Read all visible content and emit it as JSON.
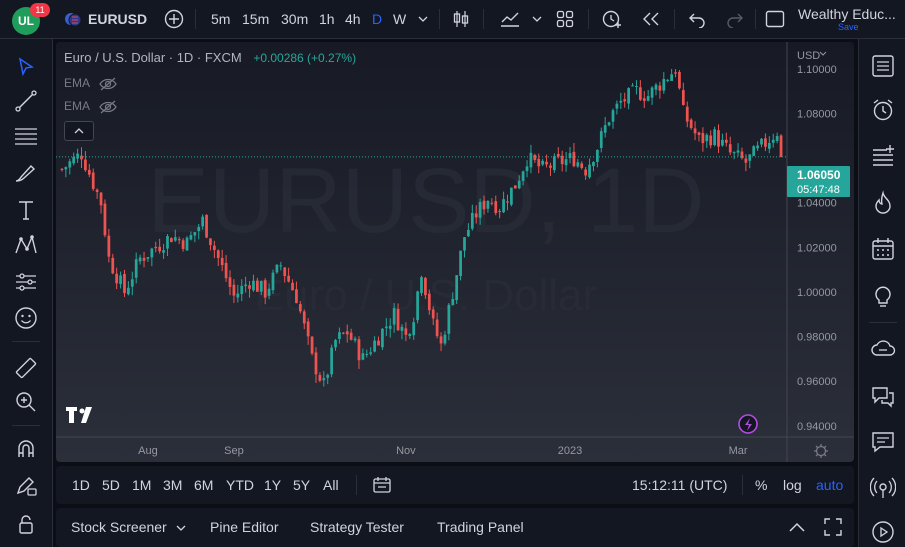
{
  "topbar": {
    "logo_text": "UL",
    "notification_count": "11",
    "symbol": "EURUSD",
    "intervals": [
      "5m",
      "15m",
      "30m",
      "1h",
      "4h",
      "D",
      "W"
    ],
    "active_interval": "D",
    "account_name": "Wealthy Educ...",
    "save_label": "Save",
    "accent_color": "#2962ff"
  },
  "legend": {
    "symbol_title": "Euro / U.S. Dollar · 1D · FXCM",
    "change": "+0.00286 (+0.27%)",
    "change_color": "#26a69a",
    "indicators": [
      "EMA",
      "EMA"
    ]
  },
  "watermark": {
    "line1": "EURUSD, 1D",
    "line2": "Euro / U.S. Dollar"
  },
  "price_axis": {
    "currency": "USD",
    "current_price": "1.06050",
    "countdown": "05:47:48",
    "current_price_color": "#26a69a"
  },
  "bottom_toolbar": {
    "ranges": [
      "1D",
      "5D",
      "1M",
      "3M",
      "6M",
      "YTD",
      "1Y",
      "5Y",
      "All"
    ],
    "time": "15:12:11 (UTC)",
    "percent": "%",
    "log": "log",
    "auto": "auto"
  },
  "panel_bar": {
    "tabs": [
      "Stock Screener",
      "Pine Editor",
      "Strategy Tester",
      "Trading Panel"
    ]
  },
  "chart_data": {
    "type": "candlestick",
    "y_ticks": [
      "1.10000",
      "1.08000",
      "1.04000",
      "1.02000",
      "1.00000",
      "0.98000",
      "0.96000",
      "0.94000"
    ],
    "ylim": [
      0.935,
      1.112
    ],
    "x_ticks": [
      {
        "label": "Aug",
        "index": 22
      },
      {
        "label": "Sep",
        "index": 44
      },
      {
        "label": "Nov",
        "index": 88
      },
      {
        "label": "2023",
        "index": 130
      },
      {
        "label": "Mar",
        "index": 173
      }
    ],
    "n_bars": 185,
    "anchors": [
      [
        0,
        1.055
      ],
      [
        5,
        1.062
      ],
      [
        10,
        1.04
      ],
      [
        12,
        1.015
      ],
      [
        16,
        1.0
      ],
      [
        20,
        1.015
      ],
      [
        24,
        1.02
      ],
      [
        28,
        1.025
      ],
      [
        32,
        1.022
      ],
      [
        36,
        1.032
      ],
      [
        40,
        1.015
      ],
      [
        44,
        0.998
      ],
      [
        48,
        1.005
      ],
      [
        52,
        1.0
      ],
      [
        56,
        1.012
      ],
      [
        60,
        0.998
      ],
      [
        64,
        0.97
      ],
      [
        67,
        0.958
      ],
      [
        70,
        0.978
      ],
      [
        73,
        0.982
      ],
      [
        77,
        0.97
      ],
      [
        81,
        0.98
      ],
      [
        85,
        0.99
      ],
      [
        88,
        0.98
      ],
      [
        90,
        0.99
      ],
      [
        92,
        1.01
      ],
      [
        95,
        0.985
      ],
      [
        97,
        0.976
      ],
      [
        100,
        1.0
      ],
      [
        103,
        1.025
      ],
      [
        106,
        1.035
      ],
      [
        109,
        1.042
      ],
      [
        112,
        1.038
      ],
      [
        116,
        1.048
      ],
      [
        119,
        1.06
      ],
      [
        123,
        1.055
      ],
      [
        127,
        1.058
      ],
      [
        131,
        1.06
      ],
      [
        134,
        1.055
      ],
      [
        137,
        1.065
      ],
      [
        140,
        1.078
      ],
      [
        143,
        1.085
      ],
      [
        147,
        1.09
      ],
      [
        150,
        1.088
      ],
      [
        154,
        1.095
      ],
      [
        157,
        1.1
      ],
      [
        159,
        1.08
      ],
      [
        163,
        1.068
      ],
      [
        167,
        1.07
      ],
      [
        171,
        1.062
      ],
      [
        175,
        1.058
      ],
      [
        179,
        1.065
      ],
      [
        183,
        1.072
      ],
      [
        184,
        1.0605
      ]
    ],
    "up_color": "#26a69a",
    "down_color": "#ef5350"
  }
}
